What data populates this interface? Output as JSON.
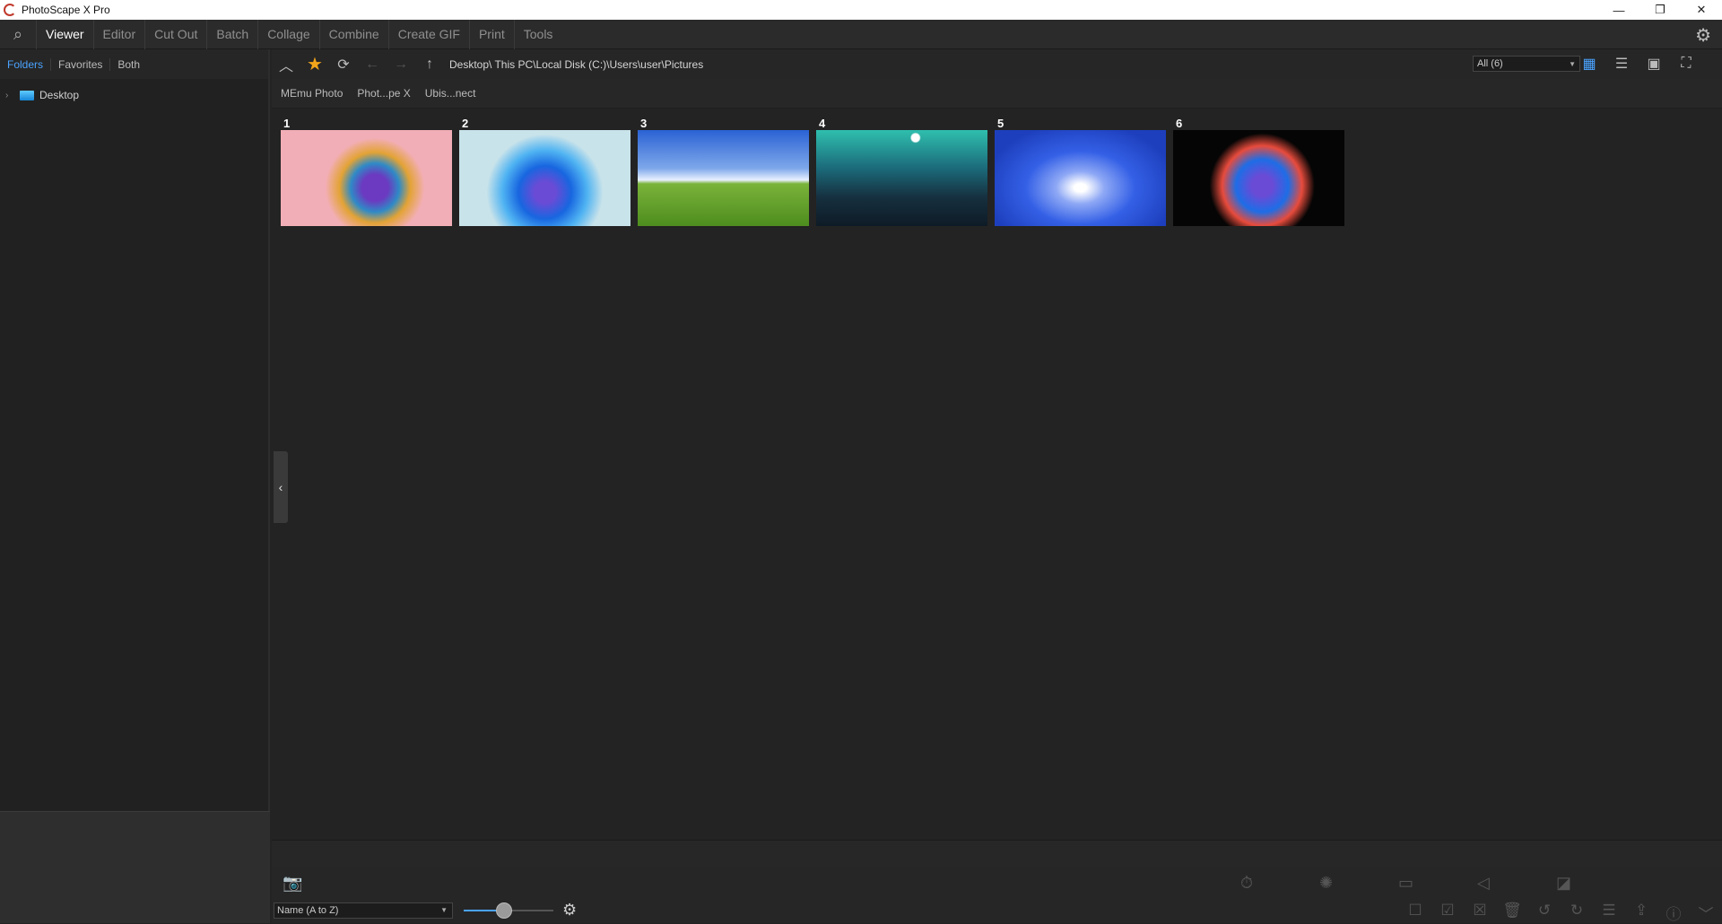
{
  "window": {
    "title": "PhotoScape X Pro",
    "minimize": "—",
    "maximize": "❐",
    "close": "✕"
  },
  "menu": {
    "items": [
      "Viewer",
      "Editor",
      "Cut Out",
      "Batch",
      "Collage",
      "Combine",
      "Create GIF",
      "Print",
      "Tools"
    ],
    "active": "Viewer"
  },
  "left": {
    "tabs": [
      "Folders",
      "Favorites",
      "Both"
    ],
    "active_tab": "Folders",
    "tree": [
      {
        "label": "Desktop"
      }
    ]
  },
  "toolbar": {
    "path": "Desktop\\ This PC\\Local Disk (C:)\\Users\\user\\Pictures",
    "filter": "All (6)"
  },
  "bookmarks": [
    "MEmu Photo",
    "Phot...pe X",
    "Ubis...nect"
  ],
  "thumbnails": [
    {
      "num": "1",
      "style": "t1"
    },
    {
      "num": "2",
      "style": "t2"
    },
    {
      "num": "3",
      "style": "t3"
    },
    {
      "num": "4",
      "style": "t4"
    },
    {
      "num": "5",
      "style": "t5"
    },
    {
      "num": "6",
      "style": "t6"
    }
  ],
  "statusbar": {
    "sort": "Name (A to Z)",
    "zoom_fraction": 0.45
  },
  "colors": {
    "accent": "#4aa3ff",
    "star": "#f2a51a",
    "background": "#232323"
  }
}
